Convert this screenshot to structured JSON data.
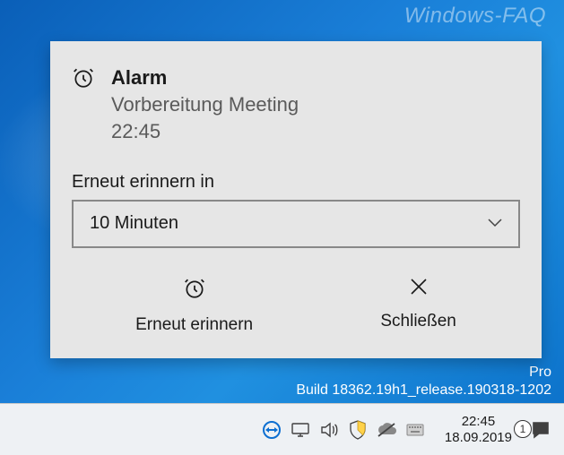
{
  "watermark": "Windows-FAQ",
  "build": {
    "edition": "Pro",
    "line": "Build 18362.19h1_release.190318-1202"
  },
  "notification": {
    "title": "Alarm",
    "subtitle": "Vorbereitung Meeting",
    "time": "22:45",
    "snooze_label": "Erneut erinnern in",
    "snooze_selected": "10 Minuten",
    "action_snooze": "Erneut erinnern",
    "action_dismiss": "Schließen"
  },
  "taskbar": {
    "clock_time": "22:45",
    "clock_date": "18.09.2019",
    "action_center_count": "1"
  }
}
